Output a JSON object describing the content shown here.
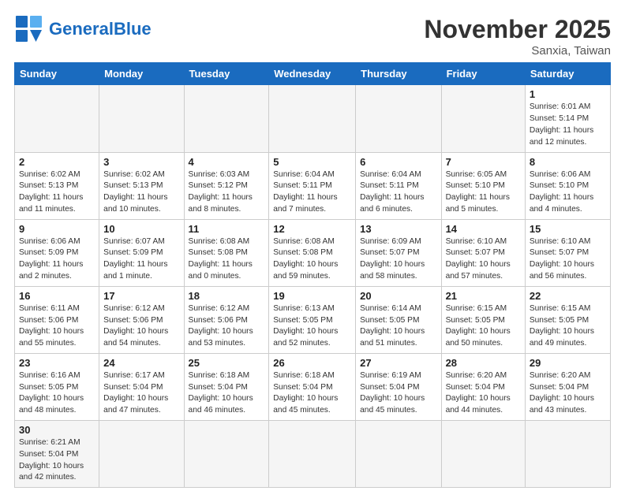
{
  "logo": {
    "text_general": "General",
    "text_blue": "Blue"
  },
  "title": "November 2025",
  "subtitle": "Sanxia, Taiwan",
  "days_of_week": [
    "Sunday",
    "Monday",
    "Tuesday",
    "Wednesday",
    "Thursday",
    "Friday",
    "Saturday"
  ],
  "weeks": [
    [
      {
        "day": "",
        "info": ""
      },
      {
        "day": "",
        "info": ""
      },
      {
        "day": "",
        "info": ""
      },
      {
        "day": "",
        "info": ""
      },
      {
        "day": "",
        "info": ""
      },
      {
        "day": "",
        "info": ""
      },
      {
        "day": "1",
        "info": "Sunrise: 6:01 AM\nSunset: 5:14 PM\nDaylight: 11 hours and 12 minutes."
      }
    ],
    [
      {
        "day": "2",
        "info": "Sunrise: 6:02 AM\nSunset: 5:13 PM\nDaylight: 11 hours and 11 minutes."
      },
      {
        "day": "3",
        "info": "Sunrise: 6:02 AM\nSunset: 5:13 PM\nDaylight: 11 hours and 10 minutes."
      },
      {
        "day": "4",
        "info": "Sunrise: 6:03 AM\nSunset: 5:12 PM\nDaylight: 11 hours and 8 minutes."
      },
      {
        "day": "5",
        "info": "Sunrise: 6:04 AM\nSunset: 5:11 PM\nDaylight: 11 hours and 7 minutes."
      },
      {
        "day": "6",
        "info": "Sunrise: 6:04 AM\nSunset: 5:11 PM\nDaylight: 11 hours and 6 minutes."
      },
      {
        "day": "7",
        "info": "Sunrise: 6:05 AM\nSunset: 5:10 PM\nDaylight: 11 hours and 5 minutes."
      },
      {
        "day": "8",
        "info": "Sunrise: 6:06 AM\nSunset: 5:10 PM\nDaylight: 11 hours and 4 minutes."
      }
    ],
    [
      {
        "day": "9",
        "info": "Sunrise: 6:06 AM\nSunset: 5:09 PM\nDaylight: 11 hours and 2 minutes."
      },
      {
        "day": "10",
        "info": "Sunrise: 6:07 AM\nSunset: 5:09 PM\nDaylight: 11 hours and 1 minute."
      },
      {
        "day": "11",
        "info": "Sunrise: 6:08 AM\nSunset: 5:08 PM\nDaylight: 11 hours and 0 minutes."
      },
      {
        "day": "12",
        "info": "Sunrise: 6:08 AM\nSunset: 5:08 PM\nDaylight: 10 hours and 59 minutes."
      },
      {
        "day": "13",
        "info": "Sunrise: 6:09 AM\nSunset: 5:07 PM\nDaylight: 10 hours and 58 minutes."
      },
      {
        "day": "14",
        "info": "Sunrise: 6:10 AM\nSunset: 5:07 PM\nDaylight: 10 hours and 57 minutes."
      },
      {
        "day": "15",
        "info": "Sunrise: 6:10 AM\nSunset: 5:07 PM\nDaylight: 10 hours and 56 minutes."
      }
    ],
    [
      {
        "day": "16",
        "info": "Sunrise: 6:11 AM\nSunset: 5:06 PM\nDaylight: 10 hours and 55 minutes."
      },
      {
        "day": "17",
        "info": "Sunrise: 6:12 AM\nSunset: 5:06 PM\nDaylight: 10 hours and 54 minutes."
      },
      {
        "day": "18",
        "info": "Sunrise: 6:12 AM\nSunset: 5:06 PM\nDaylight: 10 hours and 53 minutes."
      },
      {
        "day": "19",
        "info": "Sunrise: 6:13 AM\nSunset: 5:05 PM\nDaylight: 10 hours and 52 minutes."
      },
      {
        "day": "20",
        "info": "Sunrise: 6:14 AM\nSunset: 5:05 PM\nDaylight: 10 hours and 51 minutes."
      },
      {
        "day": "21",
        "info": "Sunrise: 6:15 AM\nSunset: 5:05 PM\nDaylight: 10 hours and 50 minutes."
      },
      {
        "day": "22",
        "info": "Sunrise: 6:15 AM\nSunset: 5:05 PM\nDaylight: 10 hours and 49 minutes."
      }
    ],
    [
      {
        "day": "23",
        "info": "Sunrise: 6:16 AM\nSunset: 5:05 PM\nDaylight: 10 hours and 48 minutes."
      },
      {
        "day": "24",
        "info": "Sunrise: 6:17 AM\nSunset: 5:04 PM\nDaylight: 10 hours and 47 minutes."
      },
      {
        "day": "25",
        "info": "Sunrise: 6:18 AM\nSunset: 5:04 PM\nDaylight: 10 hours and 46 minutes."
      },
      {
        "day": "26",
        "info": "Sunrise: 6:18 AM\nSunset: 5:04 PM\nDaylight: 10 hours and 45 minutes."
      },
      {
        "day": "27",
        "info": "Sunrise: 6:19 AM\nSunset: 5:04 PM\nDaylight: 10 hours and 45 minutes."
      },
      {
        "day": "28",
        "info": "Sunrise: 6:20 AM\nSunset: 5:04 PM\nDaylight: 10 hours and 44 minutes."
      },
      {
        "day": "29",
        "info": "Sunrise: 6:20 AM\nSunset: 5:04 PM\nDaylight: 10 hours and 43 minutes."
      }
    ],
    [
      {
        "day": "30",
        "info": "Sunrise: 6:21 AM\nSunset: 5:04 PM\nDaylight: 10 hours and 42 minutes."
      },
      {
        "day": "",
        "info": ""
      },
      {
        "day": "",
        "info": ""
      },
      {
        "day": "",
        "info": ""
      },
      {
        "day": "",
        "info": ""
      },
      {
        "day": "",
        "info": ""
      },
      {
        "day": "",
        "info": ""
      }
    ]
  ]
}
